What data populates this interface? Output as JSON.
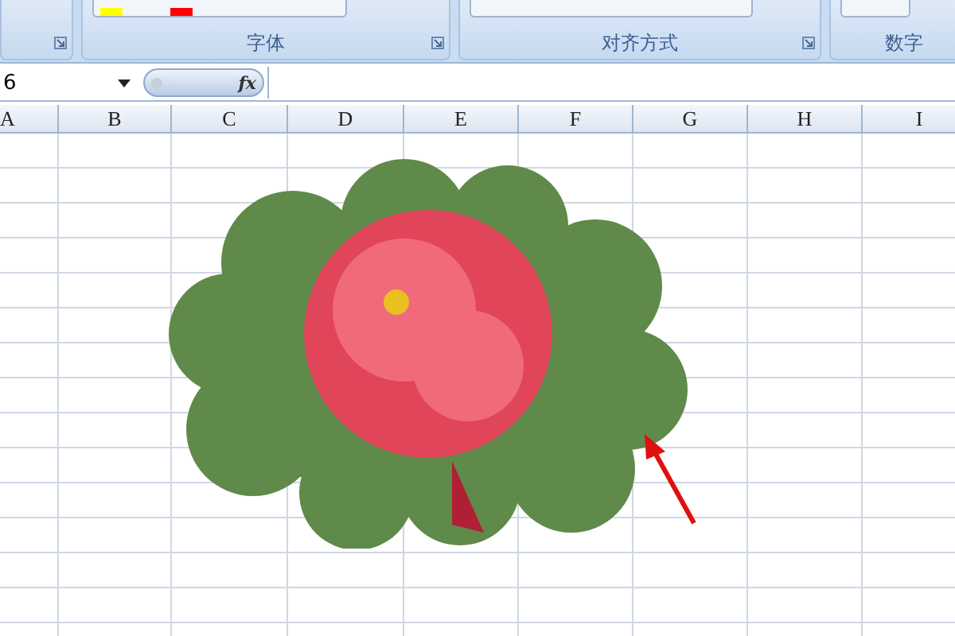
{
  "ribbon": {
    "groups": [
      {
        "label": "字体"
      },
      {
        "label": "对齐方式"
      },
      {
        "label": "数字"
      }
    ]
  },
  "formula_bar": {
    "name_box": "6",
    "fx": "fx"
  },
  "columns": [
    "A",
    "B",
    "C",
    "D",
    "E",
    "F",
    "G",
    "H",
    "I"
  ]
}
